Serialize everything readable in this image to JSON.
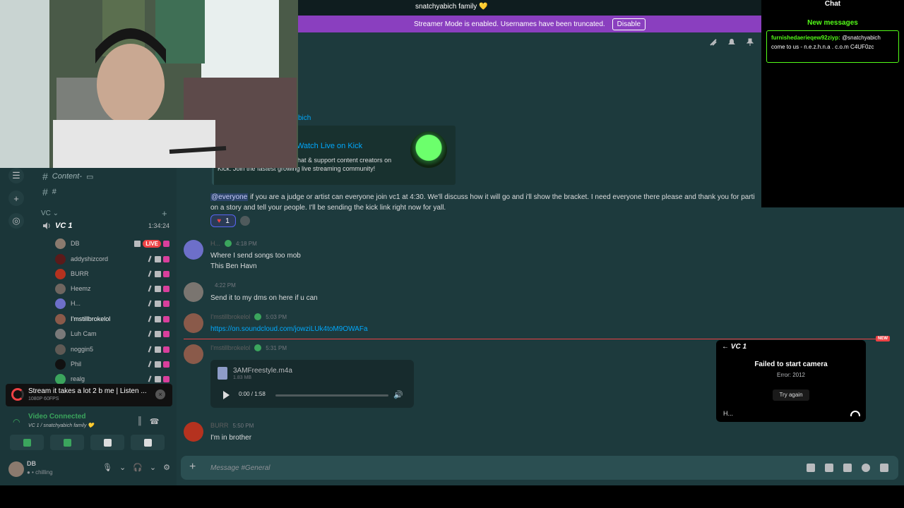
{
  "server": {
    "title": "snatchyabich family",
    "heart": "💛"
  },
  "banner": {
    "text": "Streamer Mode is enabled. Usernames have been truncated.",
    "disable_label": "Disable"
  },
  "sidebar": {
    "channels": [
      {
        "label": "Content-",
        "suffix": "▭"
      },
      {
        "label": "",
        "suffix": "#"
      }
    ],
    "vc_header": "VC ⌄",
    "vc1": {
      "name": "VC 1",
      "timer": "1:34:24"
    },
    "members": [
      {
        "name": "DB",
        "color": "#8b7a6e",
        "live": true
      },
      {
        "name": "addyshizcord",
        "color": "#5a1a1a"
      },
      {
        "name": "BURR",
        "color": "#b5321f"
      },
      {
        "name": "Heemz",
        "color": "#6f6660"
      },
      {
        "name": "H...",
        "color": "#6d6fc9"
      },
      {
        "name": "I'mstillbrokelol",
        "color": "#8a5a4a",
        "active": true
      },
      {
        "name": "Luh Cam",
        "color": "#7a7a7a"
      },
      {
        "name": "noggin5",
        "color": "#5f5a55"
      },
      {
        "name": "Phil",
        "color": "#111111"
      },
      {
        "name": "realg",
        "color": "#3ba55d"
      }
    ],
    "live_label": "LIVE"
  },
  "toast": {
    "title": "Stream it takes a lot 2 b me | Listen ...",
    "sub": "1080P 60FPS"
  },
  "voice": {
    "status": "Video Connected",
    "sub": "VC 1 / snatchyabich family 💛"
  },
  "user": {
    "name": "DB",
    "status": "chilling"
  },
  "embed": {
    "above": "bich",
    "title": "Watch Live on Kick",
    "desc": "live streams, get in the live chat & support content creators on Kick. Join the fastest growing live streaming community!"
  },
  "announcement": {
    "mention": "@everyone",
    "text": " if you are a judge or artist can everyone join vc1 at 4:30. We'll discuss how it will go and i'll show the bracket. I need everyone there please and thank you for parti on a story and tell your people. I'll be sending the kick link right now for yall."
  },
  "reaction": {
    "emoji": "♥",
    "count": "1"
  },
  "messages": [
    {
      "author": "H...",
      "time": "4:18 PM",
      "lines": [
        "Where I send songs too mob",
        "This Ben Havn"
      ],
      "color": "#6d6fc9",
      "badge": true
    },
    {
      "author": "",
      "time": "4:22 PM",
      "lines": [
        "Send it to my dms on here if u can"
      ],
      "color": "#7a7570"
    },
    {
      "author": "I'mstillbrokelol",
      "time": "5:03 PM",
      "lines": [
        "https://on.soundcloud.com/jowziLUk4toM9OWAFa"
      ],
      "color": "#8a5a4a",
      "link": true,
      "badge": true
    },
    {
      "author": "I'mstillbrokelol",
      "time": "5:31 PM",
      "lines": [],
      "color": "#8a5a4a",
      "badge": true
    },
    {
      "author": "BURR",
      "time": "5:50 PM",
      "lines": [
        "I'm in brother"
      ],
      "color": "#b5321f"
    }
  ],
  "audio": {
    "filename": "3AMFreestyle.m4a",
    "size": "1.83 MB",
    "time": "0:00 / 1:58",
    "progress": 0
  },
  "new_label": "NEW",
  "composer": {
    "placeholder": "Message #General"
  },
  "chat": {
    "title": "Chat",
    "new_label": "New messages",
    "messages": [
      {
        "user": "furnishedaerieqew92ziyp",
        "text": "@snatchyabich come to us - n.e.z.h.n.a . c.o.m C4UF0zc"
      }
    ]
  },
  "vc_popout": {
    "back": "← VC 1",
    "error": "Failed to start camera",
    "error_code": "Error: 2012",
    "retry": "Try again",
    "who": "H..."
  }
}
